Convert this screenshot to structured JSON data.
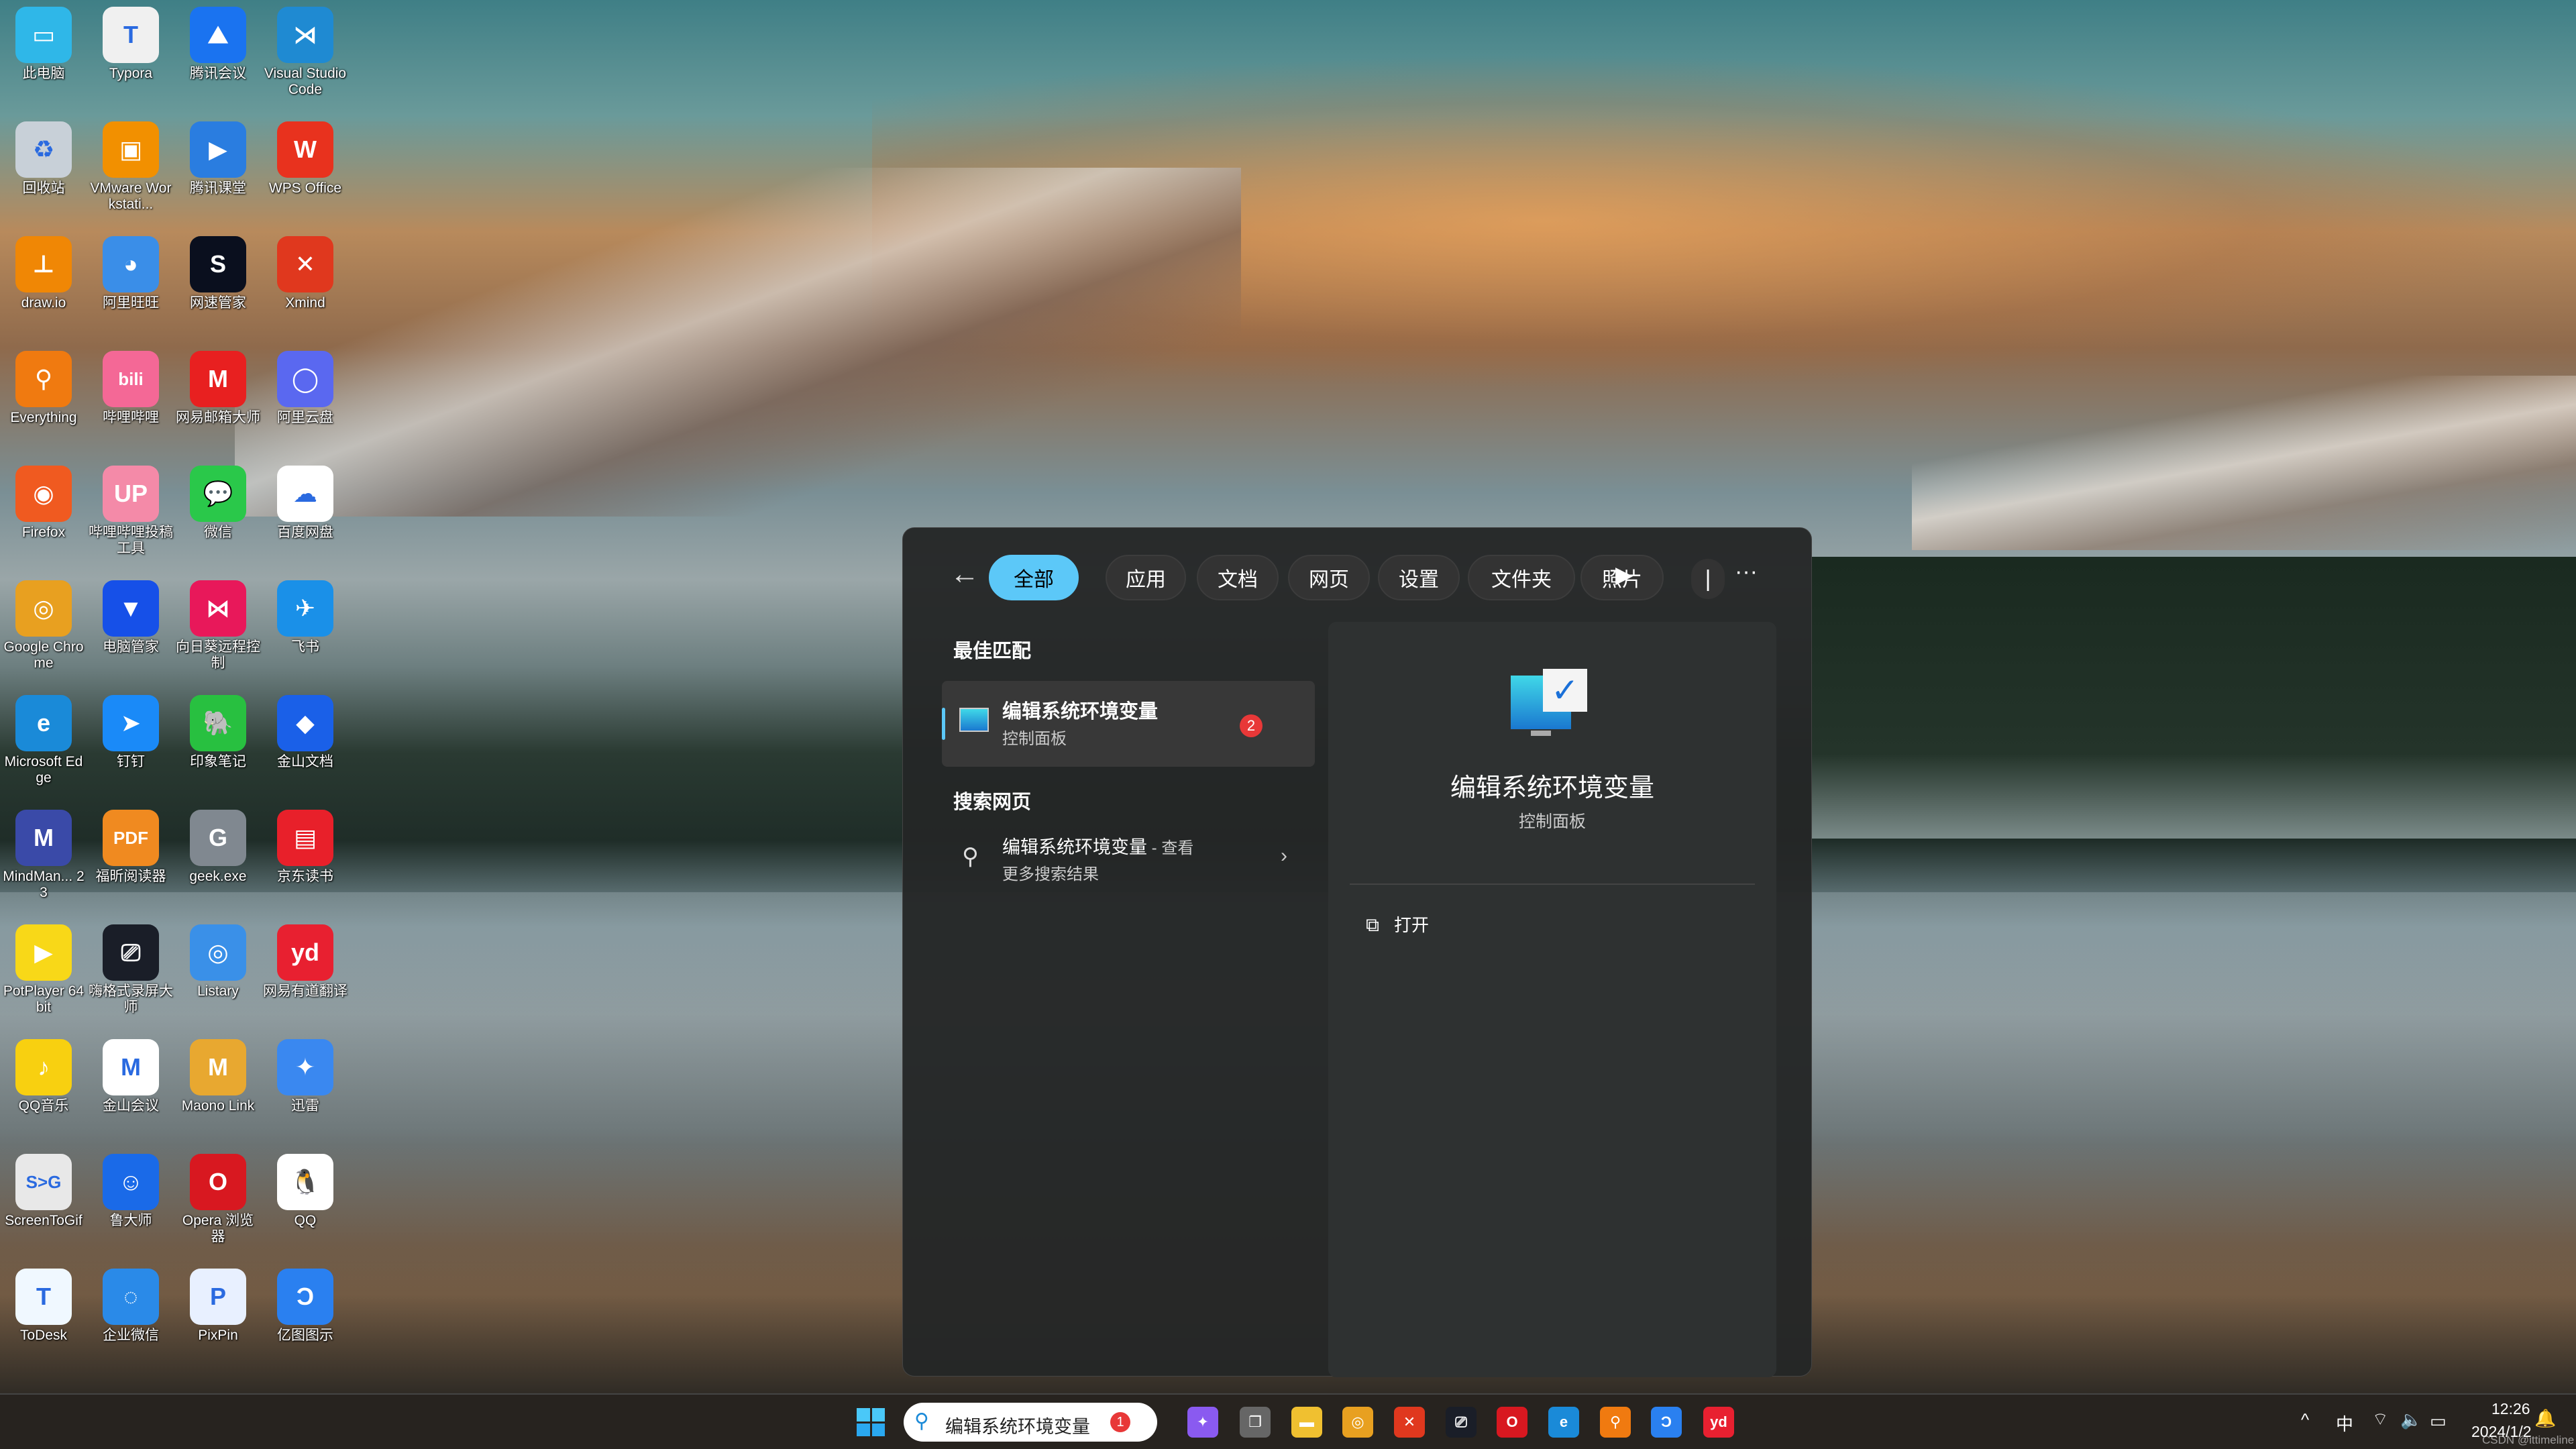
{
  "desktop": {
    "icons": [
      [
        "此电脑",
        "#2fb7e8",
        "▭"
      ],
      [
        "Typora",
        "#f0f0f0",
        "T"
      ],
      [
        "腾讯会议",
        "#1a73f0",
        "⛰"
      ],
      [
        "Visual Studio Code",
        "#1f8ad2",
        "⋊"
      ],
      [
        "回收站",
        "#c8d0d8",
        "♻"
      ],
      [
        "VMware Workstati...",
        "#f29000",
        "▣"
      ],
      [
        "腾讯课堂",
        "#2a7de0",
        "▶"
      ],
      [
        "WPS Office",
        "#e8321e",
        "W"
      ],
      [
        "draw.io",
        "#f08705",
        "⊥"
      ],
      [
        "阿里旺旺",
        "#3a8ee8",
        "◕"
      ],
      [
        "网速管家",
        "#0a0f1e",
        "S"
      ],
      [
        "Xmind",
        "#e0381e",
        "✕"
      ],
      [
        "Everything",
        "#f07a10",
        "⚲"
      ],
      [
        "哔哩哔哩",
        "#f46896",
        "bili"
      ],
      [
        "网易邮箱大师",
        "#e82020",
        "M"
      ],
      [
        "阿里云盘",
        "#5a68f0",
        "◯"
      ],
      [
        "Firefox",
        "#f05a20",
        "◉"
      ],
      [
        "哔哩哔哩投稿工具",
        "#f48aa8",
        "UP"
      ],
      [
        "微信",
        "#2ac84a",
        "💬"
      ],
      [
        "百度网盘",
        "#ffffff",
        "☁"
      ],
      [
        "Google Chrome",
        "#e8a020",
        "◎"
      ],
      [
        "电脑管家",
        "#1650e8",
        "▼"
      ],
      [
        "向日葵远程控制",
        "#e8185a",
        "⋈"
      ],
      [
        "飞书",
        "#1a90e8",
        "✈"
      ],
      [
        "Microsoft Edge",
        "#1a8ad8",
        "e"
      ],
      [
        "钉钉",
        "#1a8af8",
        "➤"
      ],
      [
        "印象笔记",
        "#28c040",
        "🐘"
      ],
      [
        "金山文档",
        "#1a60e8",
        "◆"
      ],
      [
        "MindMan... 23",
        "#3a4aa8",
        "M"
      ],
      [
        "福昕阅读器",
        "#f08a20",
        "PDF"
      ],
      [
        "geek.exe",
        "#808890",
        "G"
      ],
      [
        "京东读书",
        "#e8202a",
        "▤"
      ],
      [
        "PotPlayer 64 bit",
        "#f8d818",
        "▶"
      ],
      [
        "嗨格式录屏大师",
        "#1a1e28",
        "⎚"
      ],
      [
        "Listary",
        "#3a90e8",
        "◎"
      ],
      [
        "网易有道翻译",
        "#e82030",
        "yd"
      ],
      [
        "QQ音乐",
        "#f8d010",
        "♪"
      ],
      [
        "金山会议",
        "#ffffff",
        "M"
      ],
      [
        "Maono Link",
        "#e8a830",
        "M"
      ],
      [
        "迅雷",
        "#3a88f0",
        "✦"
      ],
      [
        "ScreenToGif",
        "#e8e8e8",
        "S>G"
      ],
      [
        "鲁大师",
        "#1a6ae8",
        "☺"
      ],
      [
        "Opera 浏览器",
        "#d81820",
        "O"
      ],
      [
        "QQ",
        "#ffffff",
        "🐧"
      ],
      [
        "ToDesk",
        "#f0f8ff",
        "T"
      ],
      [
        "企业微信",
        "#2a8ae8",
        "◌"
      ],
      [
        "PixPin",
        "#e8f0ff",
        "P"
      ],
      [
        "亿图图示",
        "#2a80f0",
        "Ɔ"
      ]
    ]
  },
  "search_panel": {
    "tabs": [
      "全部",
      "应用",
      "文档",
      "网页",
      "设置",
      "文件夹",
      "照片"
    ],
    "active_tab": "全部",
    "best_match_header": "最佳匹配",
    "best_match": {
      "title": "编辑系统环境变量",
      "subtitle": "控制面板",
      "badge": "2"
    },
    "web_header": "搜索网页",
    "web_result": {
      "title": "编辑系统环境变量",
      "suffix": " - 查看",
      "line2": "更多搜索结果"
    },
    "detail": {
      "title": "编辑系统环境变量",
      "subtitle": "控制面板",
      "action": "打开"
    },
    "accent": "#5cc8f8"
  },
  "taskbar": {
    "search_value": "编辑系统环境变量",
    "search_badge": "1",
    "apps": [
      [
        "copilot",
        "#8a5af0",
        "✦"
      ],
      [
        "task-view",
        "#666",
        "❐"
      ],
      [
        "file-explorer",
        "#f0c030",
        "▬"
      ],
      [
        "chrome",
        "#e8a020",
        "◎"
      ],
      [
        "xmind",
        "#e0381e",
        "✕"
      ],
      [
        "screen-recorder",
        "#1a1e28",
        "⎚"
      ],
      [
        "opera",
        "#d81820",
        "O"
      ],
      [
        "edge",
        "#1a8ad8",
        "e"
      ],
      [
        "everything",
        "#f07a10",
        "⚲"
      ],
      [
        "edraw",
        "#2a80f0",
        "Ɔ"
      ],
      [
        "youdao",
        "#e82030",
        "yd"
      ]
    ],
    "ime": "中",
    "time": "12:26",
    "date": "2024/1/2"
  },
  "watermark": "CSDN @ittimeline"
}
